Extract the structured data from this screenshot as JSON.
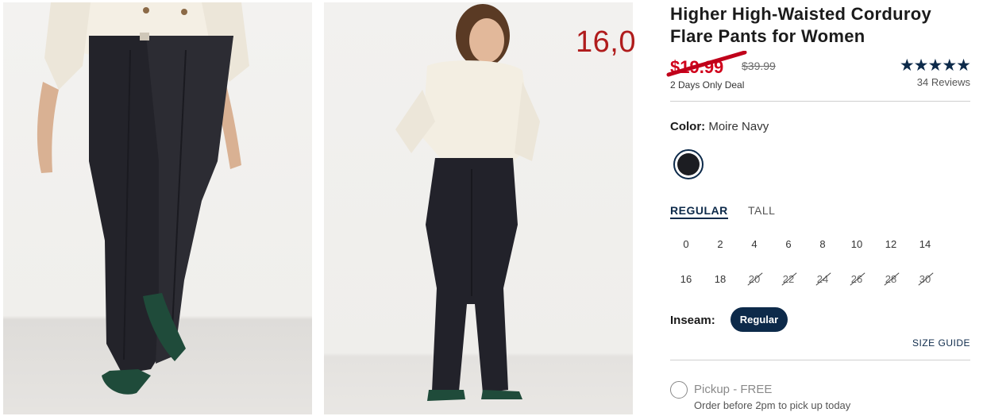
{
  "overlay": {
    "price_text": "16,0"
  },
  "product": {
    "title": "Higher High-Waisted Corduroy Flare Pants for Women",
    "sale_price": "$19.99",
    "original_price": "$39.99",
    "deal_label": "2 Days Only Deal",
    "rating_stars": "★★★★★",
    "rating_value": 5,
    "reviews": "34 Reviews"
  },
  "color": {
    "label": "Color:",
    "value": "Moire Navy",
    "swatch_hex": "#1c1d22"
  },
  "fit": {
    "tabs": [
      "REGULAR",
      "TALL"
    ],
    "selected": "REGULAR"
  },
  "sizes": {
    "row1": [
      "0",
      "2",
      "4",
      "6",
      "8",
      "10",
      "12",
      "14"
    ],
    "row2": [
      "16",
      "18",
      "20",
      "22",
      "24",
      "26",
      "28",
      "30"
    ],
    "unavailable": [
      "20",
      "22",
      "24",
      "26",
      "28",
      "30"
    ]
  },
  "inseam": {
    "label": "Inseam:",
    "selected": "Regular"
  },
  "size_guide": "SIZE GUIDE",
  "pickup": {
    "label": "Pickup - FREE",
    "note": "Order before 2pm to pick up today"
  },
  "colors": {
    "brand_navy": "#0d2a4a",
    "sale_red": "#d0021b",
    "overlay_red": "#b01c1c"
  }
}
